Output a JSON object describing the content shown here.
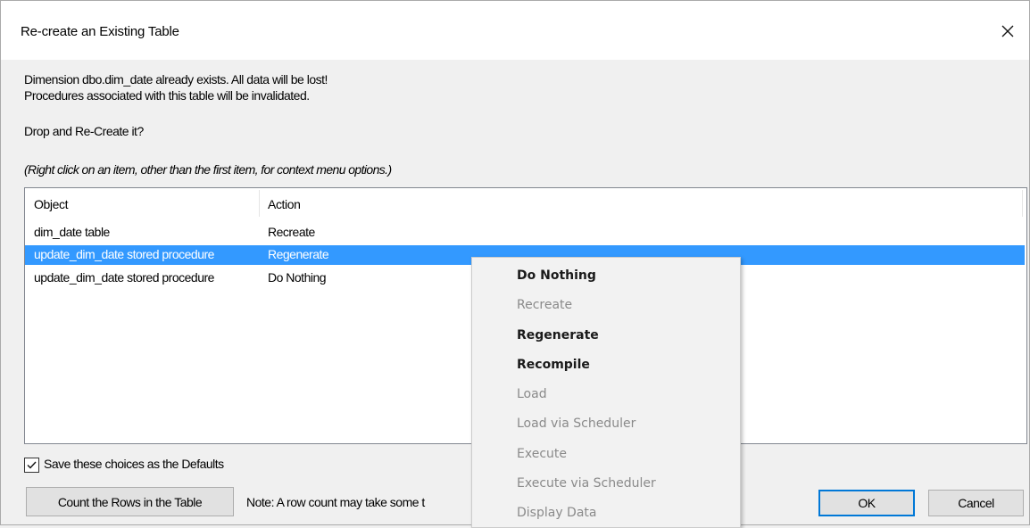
{
  "dialog": {
    "title": "Re-create an Existing Table",
    "close_label": "Close"
  },
  "message": {
    "line1": "Dimension dbo.dim_date already exists. All data will be lost!",
    "line2": "Procedures associated with this table will be invalidated.",
    "question": "Drop and Re-Create it?",
    "hint": "(Right click on an item, other than the first item, for context menu options.)"
  },
  "list": {
    "columns": [
      "Object",
      "Action"
    ],
    "rows": [
      {
        "object": "dim_date table",
        "action": "Recreate"
      },
      {
        "object": "update_dim_date stored procedure",
        "action": "Regenerate"
      },
      {
        "object": "update_dim_date stored procedure",
        "action": "Do Nothing"
      }
    ],
    "selected_row": 1
  },
  "checkbox": {
    "label": "Save these choices as the Defaults",
    "checked": true
  },
  "buttons": {
    "count_rows": "Count the Rows in the Table",
    "note": "Note: A row count may take some t",
    "ok": "OK",
    "cancel": "Cancel"
  },
  "context_menu": {
    "items": [
      {
        "label": "Do Nothing",
        "enabled": true
      },
      {
        "label": "Recreate",
        "enabled": false
      },
      {
        "label": "Regenerate",
        "enabled": true
      },
      {
        "label": "Recompile",
        "enabled": true
      },
      {
        "label": "Load",
        "enabled": false
      },
      {
        "label": "Load via Scheduler",
        "enabled": false
      },
      {
        "label": "Execute",
        "enabled": false
      },
      {
        "label": "Execute via Scheduler",
        "enabled": false
      },
      {
        "label": "Display Data",
        "enabled": false
      }
    ]
  },
  "colors": {
    "selection": "#3399ff",
    "accent": "#0078d7"
  }
}
